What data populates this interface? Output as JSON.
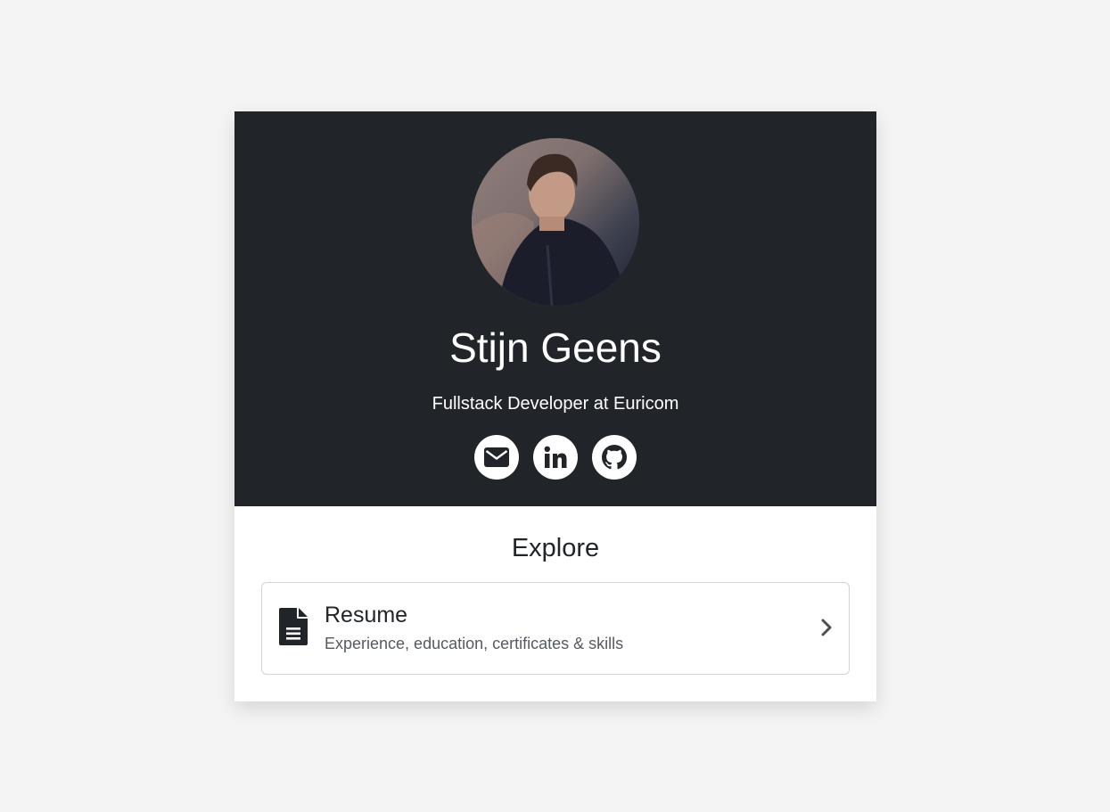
{
  "profile": {
    "name": "Stijn Geens",
    "subtitle": "Fullstack Developer at Euricom",
    "avatar_alt": "Profile photo",
    "socials": [
      {
        "icon": "envelope-icon",
        "label": "Email"
      },
      {
        "icon": "linkedin-icon",
        "label": "LinkedIn"
      },
      {
        "icon": "github-icon",
        "label": "GitHub"
      }
    ]
  },
  "explore": {
    "title": "Explore",
    "items": [
      {
        "icon": "file-text-icon",
        "title": "Resume",
        "description": "Experience, education, certificates & skills"
      }
    ]
  },
  "colors": {
    "hero_bg": "#212529",
    "page_bg": "#f4f4f4",
    "text_dark": "#212529",
    "text_muted": "#555a60"
  }
}
